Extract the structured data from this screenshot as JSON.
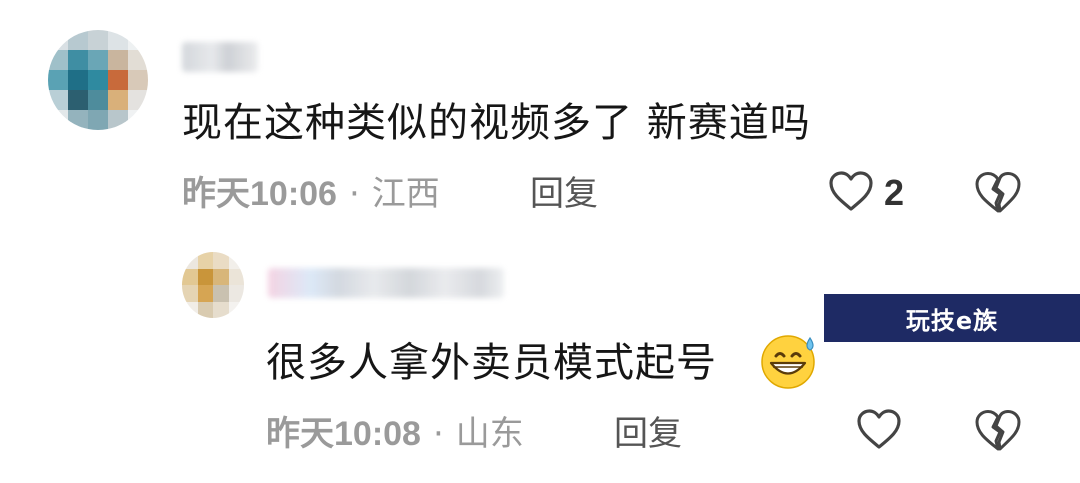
{
  "comments": [
    {
      "text": "现在这种类似的视频多了 新赛道吗",
      "time": "昨天10:06",
      "separator": "·",
      "location": "江西",
      "reply_label": "回复",
      "likes": "2"
    },
    {
      "text": "很多人拿外卖员模式起号",
      "time": "昨天10:08",
      "separator": "·",
      "location": "山东",
      "reply_label": "回复",
      "likes": ""
    }
  ],
  "watermark": {
    "text": "玩技e族"
  },
  "icons": {
    "like": "heart-outline-icon",
    "dislike": "broken-heart-icon",
    "emoji": "grinning-sweat-emoji"
  },
  "colors": {
    "text_primary": "#161616",
    "text_meta": "#9a9a9a",
    "reply": "#555555",
    "icon": "#444444",
    "watermark_bg": "#1e2a64"
  }
}
